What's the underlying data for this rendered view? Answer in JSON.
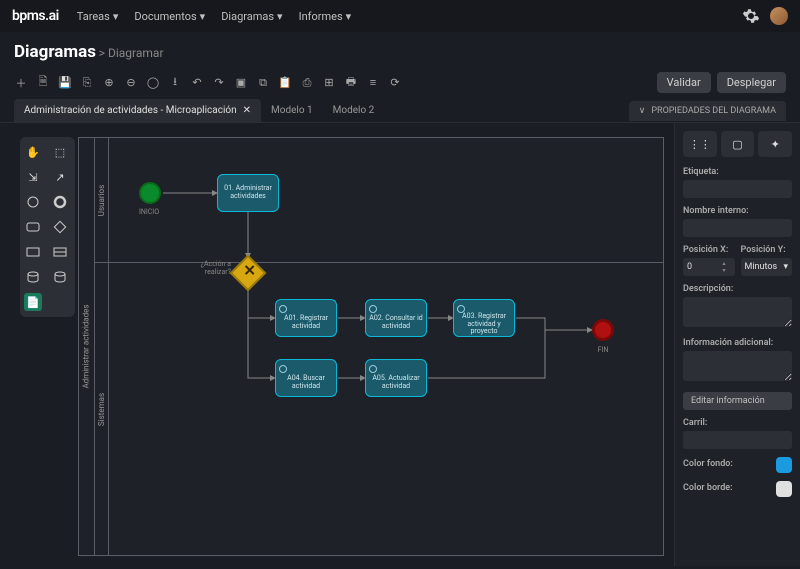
{
  "brand": "bpms.ai",
  "nav": {
    "items": [
      "Tareas",
      "Documentos",
      "Diagramas",
      "Informes"
    ]
  },
  "page": {
    "title": "Diagramas",
    "crumb": "Diagramar"
  },
  "actions": {
    "validate": "Validar",
    "deploy": "Desplegar"
  },
  "tabs": {
    "active": "Administración de actividades - Microaplicación",
    "others": [
      "Modelo 1",
      "Modelo 2"
    ]
  },
  "props_header": "PROPIEDADES DEL DIAGRAMA",
  "diagram": {
    "pool": "Administrar actividades",
    "lanes": [
      "Usuarios",
      "Sistemas"
    ],
    "start": {
      "label": "INICIO"
    },
    "end": {
      "label": "FIN"
    },
    "gateway": {
      "label": "¿Acción a realizar?"
    },
    "tasks": {
      "t01": "01. Administrar actividades",
      "a01": "A01. Registrar actividad",
      "a02": "A02. Consultar id actividad",
      "a03": "A03. Registrar actividad y proyecto",
      "a04": "A04. Buscar actividad",
      "a05": "A05. Actualizar actividad"
    }
  },
  "props": {
    "etiqueta": {
      "label": "Etiqueta:",
      "value": ""
    },
    "nombre_interno": {
      "label": "Nombre interno:",
      "value": ""
    },
    "posx": {
      "label": "Posición X:",
      "value": "0"
    },
    "posy": {
      "label": "Posición Y:",
      "value": "Minutos"
    },
    "descripcion": {
      "label": "Descripción:"
    },
    "info_adicional": {
      "label": "Información adicional:"
    },
    "editar": "Editar información",
    "carril": {
      "label": "Carril:"
    },
    "color_fondo": {
      "label": "Color fondo:",
      "value": "#1a9be0"
    },
    "color_borde": {
      "label": "Color borde:",
      "value": "#e0e0e0"
    }
  },
  "palette_names": [
    "hand-icon",
    "cursor-icon",
    "fit-icon",
    "connect-icon",
    "circle-icon",
    "circle-bold-icon",
    "square-icon",
    "diamond-icon",
    "rect-icon",
    "rect-lines-icon",
    "db-icon",
    "db2-icon",
    "sheet-icon"
  ]
}
